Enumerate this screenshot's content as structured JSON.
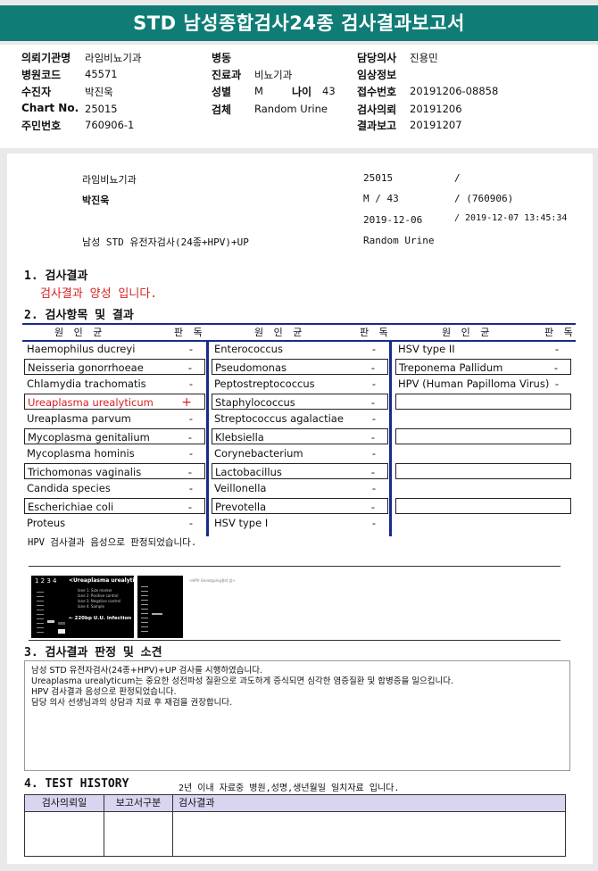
{
  "title": "STD 남성종합검사24종 검사결과보고서",
  "header": {
    "col1": [
      {
        "label": "의뢰기관명",
        "value": "라임비뇨기과"
      },
      {
        "label": "병원코드",
        "value": "45571"
      },
      {
        "label": "수진자",
        "value": "박진욱"
      },
      {
        "label": "Chart No.",
        "value": "25015"
      },
      {
        "label": "주민번호",
        "value": "760906-1"
      }
    ],
    "col2": [
      {
        "label": "병동",
        "value": ""
      },
      {
        "label": "진료과",
        "value": "비뇨기과"
      },
      {
        "label": "성별",
        "value": "M"
      },
      {
        "label": "검체",
        "value": "Random Urine"
      }
    ],
    "age_label": "나이",
    "age_value": "43",
    "col3": [
      {
        "label": "담당의사",
        "value": "진용민"
      },
      {
        "label": "임상정보",
        "value": ""
      },
      {
        "label": "접수번호",
        "value": "20191206-08858"
      },
      {
        "label": "검사의뢰",
        "value": "20191206"
      },
      {
        "label": "결과보고",
        "value": "20191207"
      }
    ]
  },
  "report": {
    "clinic": "라임비뇨기과",
    "chart": "25015",
    "slash1": "/",
    "patient": "박진욱",
    "sex_age": "M  /  43",
    "birth": "/ (760906)",
    "req_date": "2019-12-06",
    "rep_datetime": "/ 2019-12-07 13:45:34",
    "test_name": "남성 STD 유전자검사(24종+HPV)+UP",
    "specimen": "Random Urine"
  },
  "sections": {
    "s1": "1. 검사결과",
    "s1_text": "검사결과 양성 입니다.",
    "s2": "2. 검사항목 및 결과",
    "s3": "3. 검사결과 판정 및 소견",
    "s4": "4. TEST HISTORY",
    "s4_note": "2년 이내 자료중 병원,성명,생년월일 일치자료 입니다."
  },
  "table_head": {
    "organism": "원 인 균",
    "result": "판 독"
  },
  "col1_items": [
    {
      "name": "Haemophilus ducreyi",
      "result": "-"
    },
    {
      "name": "Neisseria gonorrhoeae",
      "result": "-"
    },
    {
      "name": "Chlamydia trachomatis",
      "result": "-"
    },
    {
      "name": "Ureaplasma urealyticum",
      "result": "+"
    },
    {
      "name": "Ureaplasma parvum",
      "result": "-"
    },
    {
      "name": "Mycoplasma genitalium",
      "result": "-"
    },
    {
      "name": "Mycoplasma hominis",
      "result": "-"
    },
    {
      "name": "Trichomonas vaginalis",
      "result": "-"
    },
    {
      "name": "Candida species",
      "result": "-"
    },
    {
      "name": "Escherichiae coli",
      "result": "-"
    },
    {
      "name": "Proteus",
      "result": "-"
    }
  ],
  "col2_items": [
    {
      "name": "Enterococcus",
      "result": "-"
    },
    {
      "name": "Pseudomonas",
      "result": "-"
    },
    {
      "name": "Peptostreptococcus",
      "result": "-"
    },
    {
      "name": "Staphylococcus",
      "result": "-"
    },
    {
      "name": "Streptococcus agalactiae",
      "result": "-"
    },
    {
      "name": "Klebsiella",
      "result": "-"
    },
    {
      "name": "Corynebacterium",
      "result": "-"
    },
    {
      "name": "Lactobacillus",
      "result": "-"
    },
    {
      "name": "Veillonella",
      "result": "-"
    },
    {
      "name": "Prevotella",
      "result": "-"
    },
    {
      "name": "HSV type I",
      "result": "-"
    }
  ],
  "col3_items": [
    {
      "name": "HSV type II",
      "result": "-"
    },
    {
      "name": "Treponema Pallidum",
      "result": "-"
    },
    {
      "name": "HPV (Human Papilloma Virus)",
      "result": "-"
    }
  ],
  "hpv_note": "HPV 검사결과 음성으로 판정되었습니다.",
  "gel": {
    "title": "<Ureaplasma urealyticum>",
    "lanes": "1  2  3  4",
    "legend": [
      "lane 1. Size marker",
      "lane 2. Positive control",
      "lane 3. Negative control",
      "lane 4. Sample"
    ],
    "band_label": "← 220bp U.U. infection",
    "hpv_caption": "<HPV Genotyping결과 없>"
  },
  "opinion": [
    "남성 STD 유전자검사(24종+HPV)+UP 검사를 시행하였습니다.",
    "Ureaplasma urealyticum는 중요한 성전파성 질환으로 과도하게 증식되면 심각한 염증질환 및 합병증을 일으킵니다.",
    "HPV 검사결과 음성으로 판정되었습니다.",
    "담당 의사 선생님과의 상담과 치료 후 재검을 권장합니다."
  ],
  "history_head": [
    "검사의뢰일",
    "보고서구분",
    "검사결과"
  ],
  "colors": {
    "banner": "#0f7d75",
    "rule": "#1a2a8c",
    "positive": "#d62020",
    "history_head": "#d9d4f0"
  }
}
